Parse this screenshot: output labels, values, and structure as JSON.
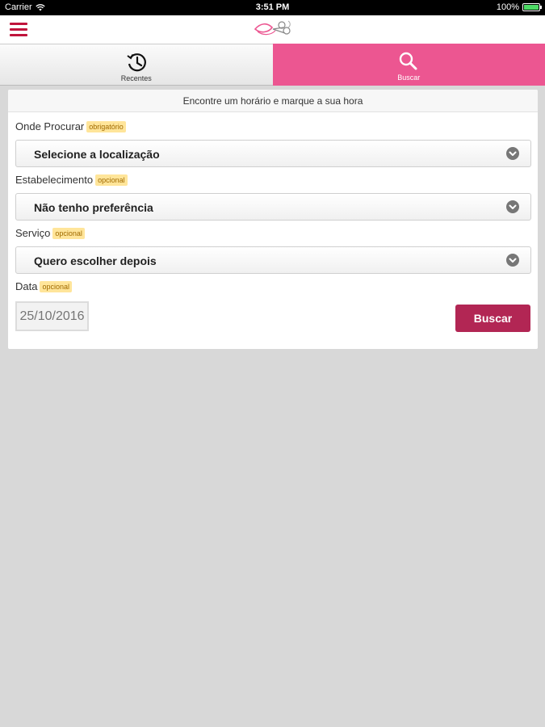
{
  "status_bar": {
    "carrier": "Carrier",
    "time": "3:51 PM",
    "battery": "100%",
    "battery_level": 1.0
  },
  "navbar": {
    "menu_icon": "hamburger-icon",
    "logo_icon": "brand-logo"
  },
  "tabs": [
    {
      "label": "Recentes",
      "icon": "history-icon",
      "active": false
    },
    {
      "label": "Buscar",
      "icon": "search-icon",
      "active": true
    }
  ],
  "colors": {
    "accent_pink": "#ec5691",
    "button_crimson": "#b22654",
    "menu_red": "#c0143c",
    "tag_yellow": "#ffe59a"
  },
  "form": {
    "title": "Encontre um horário e marque a sua hora",
    "location": {
      "label": "Onde Procurar",
      "tag": "obrigatório",
      "value": "Selecione a localização"
    },
    "establishment": {
      "label": "Estabelecimento",
      "tag": "opcional",
      "value": "Não tenho preferência"
    },
    "service": {
      "label": "Serviço",
      "tag": "opcional",
      "value": "Quero escolher depois"
    },
    "date": {
      "label": "Data",
      "tag": "opcional",
      "placeholder": "25/10/2016"
    },
    "submit_label": "Buscar"
  }
}
